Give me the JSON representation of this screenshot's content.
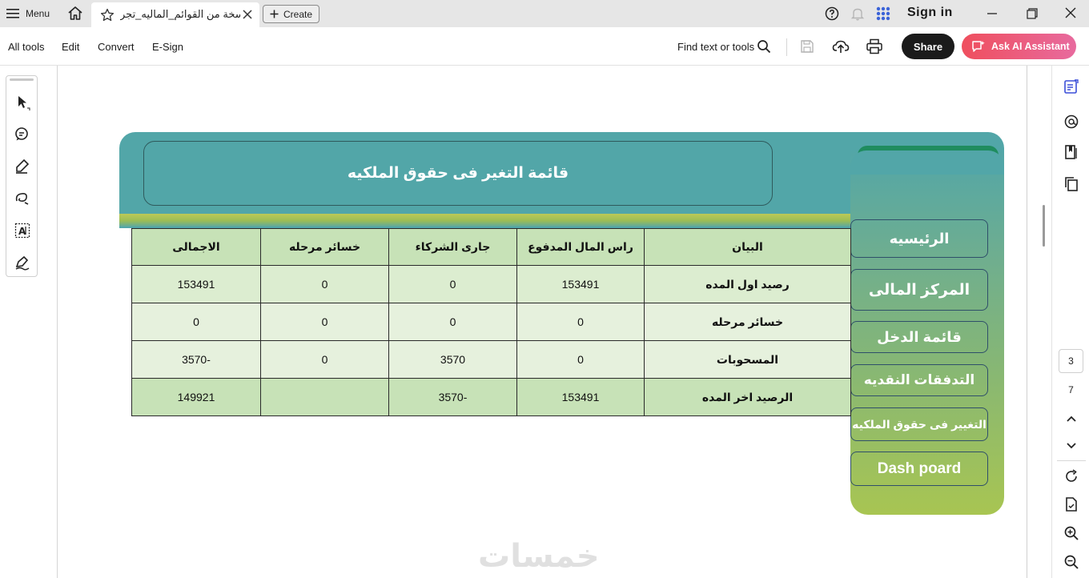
{
  "topbar": {
    "menu_label": "Menu",
    "tab_title": "نسخة من القوائم_الماليه_تجر...",
    "create_label": "Create",
    "signin_label": "Sign in"
  },
  "toolbar": {
    "items": [
      "All tools",
      "Edit",
      "Convert",
      "E-Sign"
    ],
    "find_label": "Find text or tools",
    "share_label": "Share",
    "ai_label": "Ask AI Assistant"
  },
  "document": {
    "title": "قائمة التغير فى حقوق الملكيه",
    "nav_buttons": [
      "الرئيسيه",
      "المركز المالى",
      "قائمة الدخل",
      "التدفقات النقديه",
      "التغيير فى حقوق الملكيه",
      "Dash poard"
    ],
    "table": {
      "headers": [
        "البيان",
        "راس المال المدفوع",
        "جارى الشركاء",
        "خسائر مرحله",
        "الاجمالى"
      ],
      "rows": [
        [
          "رصيد اول المده",
          "153491",
          "0",
          "0",
          "153491"
        ],
        [
          "خسائر مرحله",
          "0",
          "0",
          "0",
          "0"
        ],
        [
          "المسحوبات",
          "0",
          "3570",
          "0",
          "-3570"
        ],
        [
          "الرصيد اخر المده",
          "153491",
          "-3570",
          "",
          "149921"
        ]
      ]
    },
    "watermark": "خمسات"
  },
  "pager": {
    "current_page": "3",
    "total_pages": "7"
  },
  "colors": {
    "slide_teal": "#52a6a8",
    "slide_green": "#a8c552",
    "table_header": "#c7e2b7",
    "ai_gradient_start": "#ef4f5e"
  }
}
